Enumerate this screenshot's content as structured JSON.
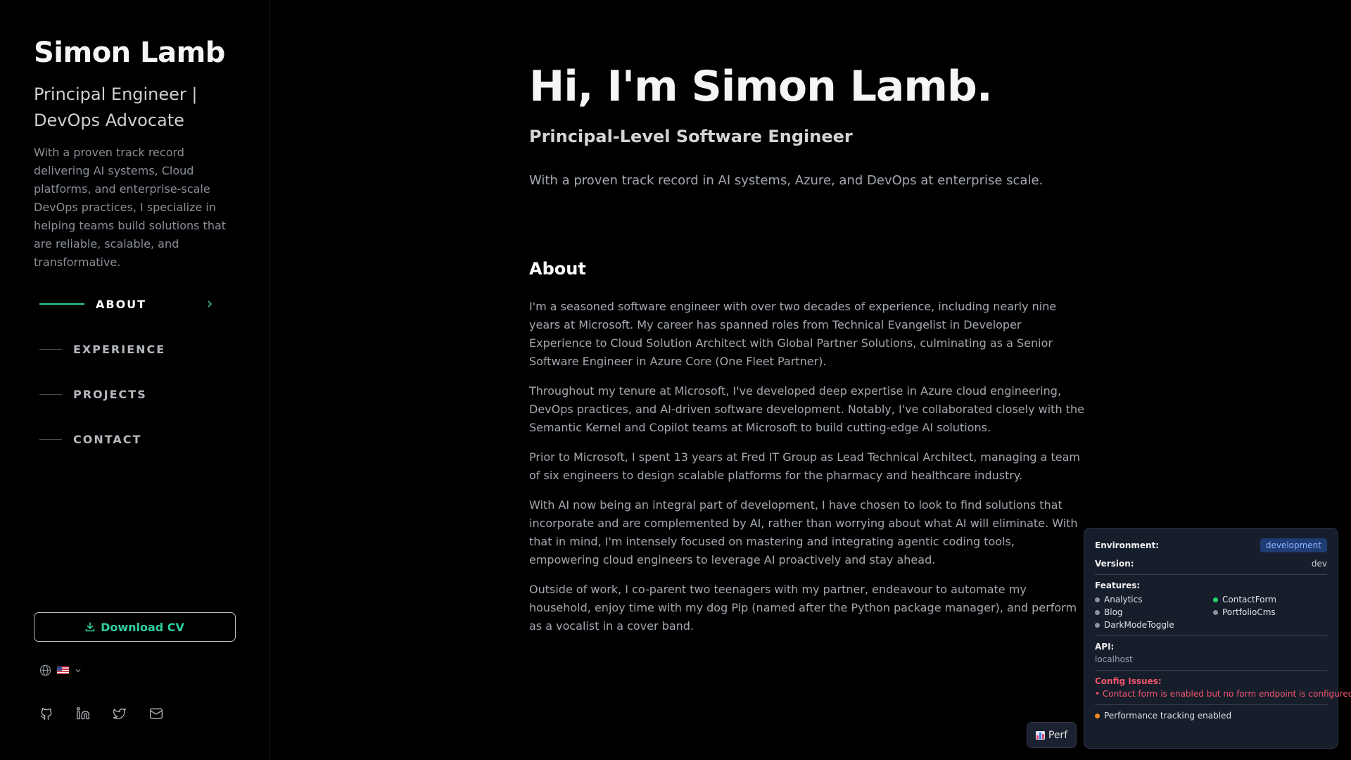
{
  "sidebar": {
    "name": "Simon Lamb",
    "title": "Principal Engineer | DevOps Advocate",
    "bio": "With a proven track record delivering AI systems, Cloud platforms, and enterprise-scale DevOps practices, I specialize in helping teams build solutions that are reliable, scalable, and transformative.",
    "nav": [
      {
        "label": "ABOUT",
        "active": true
      },
      {
        "label": "EXPERIENCE",
        "active": false
      },
      {
        "label": "PROJECTS",
        "active": false
      },
      {
        "label": "CONTACT",
        "active": false
      }
    ],
    "download_cv": "Download CV",
    "language_flag": "us-flag",
    "socials": [
      "github-icon",
      "linkedin-icon",
      "twitter-icon",
      "mail-icon"
    ]
  },
  "main": {
    "hero_title": "Hi, I'm Simon Lamb.",
    "hero_subtitle": "Principal-Level Software Engineer",
    "hero_description": "With a proven track record in AI systems, Azure, and DevOps at enterprise scale.",
    "about_heading": "About",
    "about_paragraphs": [
      "I'm a seasoned software engineer with over two decades of experience, including nearly nine years at Microsoft. My career has spanned roles from Technical Evangelist in Developer Experience to Cloud Solution Architect with Global Partner Solutions, culminating as a Senior Software Engineer in Azure Core (One Fleet Partner).",
      "Throughout my tenure at Microsoft, I've developed deep expertise in Azure cloud engineering, DevOps practices, and AI-driven software development. Notably, I've collaborated closely with the Semantic Kernel and Copilot teams at Microsoft to build cutting-edge AI solutions.",
      "Prior to Microsoft, I spent 13 years at Fred IT Group as Lead Technical Architect, managing a team of six engineers to design scalable platforms for the pharmacy and healthcare industry.",
      "With AI now being an integral part of development, I have chosen to look to find solutions that incorporate and are complemented by AI, rather than worrying about what AI will eliminate. With that in mind, I'm intensely focused on mastering and integrating agentic coding tools, empowering cloud engineers to leverage AI proactively and stay ahead.",
      "Outside of work, I co-parent two teenagers with my partner, endeavour to automate my household, enjoy time with my dog Pip (named after the Python package manager), and perform as a vocalist in a cover band."
    ]
  },
  "perf_button": {
    "label": "Perf"
  },
  "dev_panel": {
    "environment_label": "Environment:",
    "environment_value": "development",
    "version_label": "Version:",
    "version_value": "dev",
    "features_label": "Features:",
    "features": [
      {
        "name": "Analytics",
        "enabled": false
      },
      {
        "name": "ContactForm",
        "enabled": true
      },
      {
        "name": "Blog",
        "enabled": false
      },
      {
        "name": "PortfolioCms",
        "enabled": false
      },
      {
        "name": "DarkModeToggle",
        "enabled": false
      }
    ],
    "api_label": "API:",
    "api_value": "localhost",
    "issues_label": "Config Issues:",
    "issues": [
      "• Contact form is enabled but no form endpoint is configured"
    ],
    "perf_tracking": "Performance tracking enabled"
  },
  "colors": {
    "accent": "#2fd0a0",
    "background": "#000000",
    "panel_bg": "#161d2b",
    "issue_red": "#f0576b",
    "feature_on": "#22d36b"
  }
}
